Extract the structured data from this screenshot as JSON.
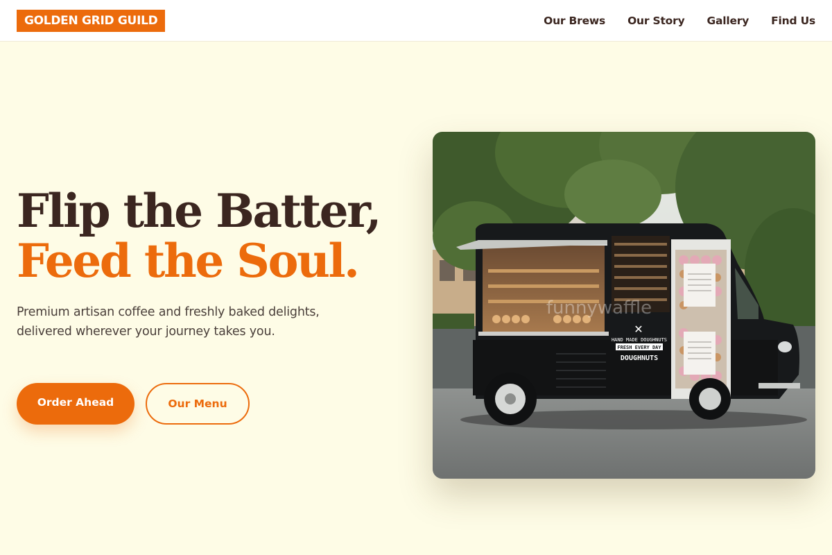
{
  "brand": {
    "name": "GOLDEN GRID GUILD",
    "accent_color": "#ec6b0c",
    "text_color": "#3b2620",
    "background_color": "#fefce6"
  },
  "nav": {
    "items": [
      {
        "label": "Our Brews"
      },
      {
        "label": "Our Story"
      },
      {
        "label": "Gallery"
      },
      {
        "label": "Find Us"
      }
    ]
  },
  "hero": {
    "title_line1": "Flip the Batter,",
    "title_line2": "Feed the Soul.",
    "subtitle": "Premium artisan coffee and freshly baked delights, delivered wherever your journey takes you.",
    "primary_button": "Order Ahead",
    "secondary_button": "Our Menu"
  },
  "image": {
    "subject": "Black food truck selling doughnuts parked on a city plaza under trees",
    "signage": {
      "line1": "HAND MADE DOUGHNUTS",
      "line2": "FRESH EVERY DAY",
      "line3": "DOUGHNUTS"
    },
    "watermark": "funnywaffle"
  }
}
